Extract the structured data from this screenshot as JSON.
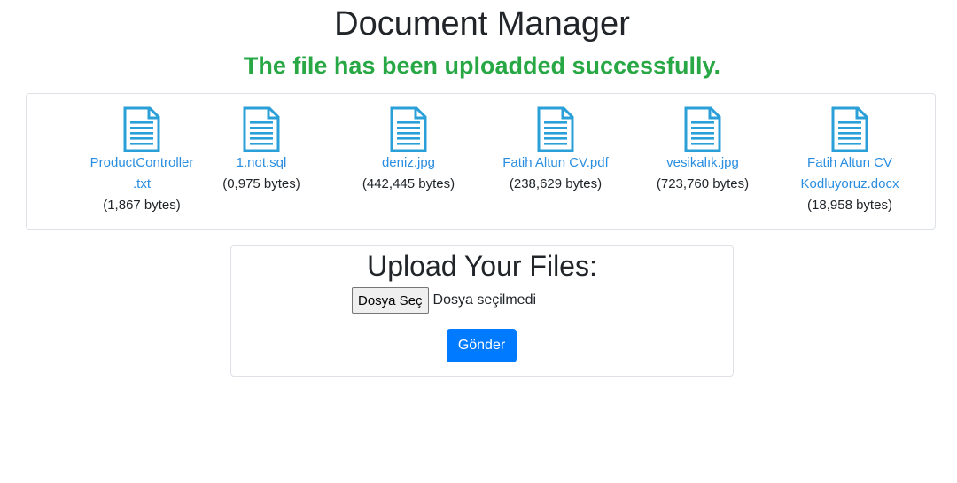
{
  "page": {
    "title": "Document Manager",
    "success_message": "The file has been uploadded successfully."
  },
  "files": [
    {
      "name": "ProductController\n.txt",
      "size": "(1,867 bytes)",
      "icon": "document-icon"
    },
    {
      "name": "1.not.sql",
      "size": "(0,975 bytes)",
      "icon": "document-icon"
    },
    {
      "name": "deniz.jpg",
      "size": "(442,445 bytes)",
      "icon": "document-icon"
    },
    {
      "name": "Fatih Altun CV.pdf",
      "size": "(238,629 bytes)",
      "icon": "document-icon"
    },
    {
      "name": "vesikalık.jpg",
      "size": "(723,760 bytes)",
      "icon": "document-icon"
    },
    {
      "name": "Fatih Altun CV\nKodluyoruz.docx",
      "size": "(18,958 bytes)",
      "icon": "document-icon"
    }
  ],
  "upload": {
    "title": "Upload Your Files:",
    "choose_label": "Dosya Seç",
    "no_file_label": "Dosya seçilmedi",
    "submit_label": "Gönder"
  },
  "colors": {
    "accent": "#007bff",
    "link": "#2a8ee0",
    "success": "#28a745",
    "icon": "#2a9fd8"
  }
}
